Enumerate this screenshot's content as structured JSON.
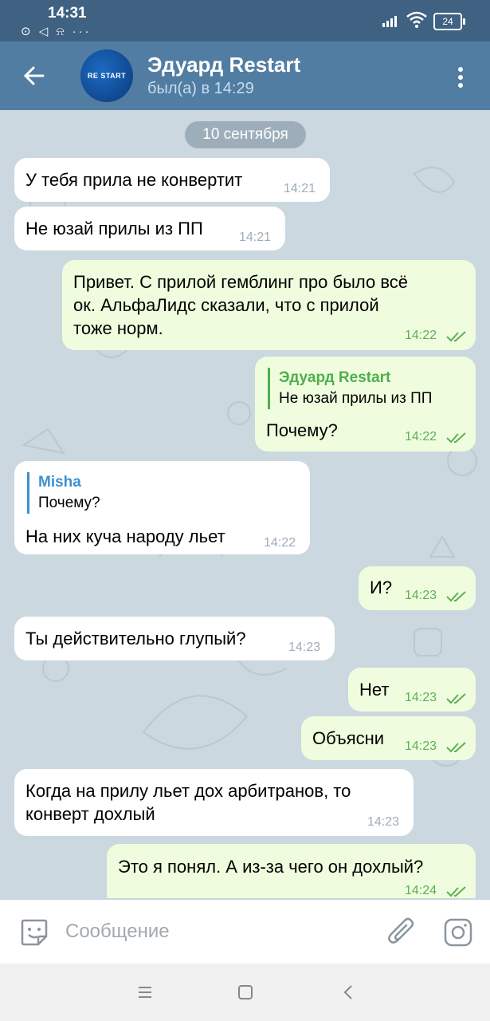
{
  "status_bar": {
    "time": "14:31",
    "left_icons": "⊙ ◁ ⍾ ···",
    "battery": "24"
  },
  "header": {
    "name": "Эдуард Restart",
    "status": "был(а) в 14:29",
    "avatar_text": "RE START"
  },
  "date_separator": "10 сентября",
  "messages": [
    {
      "dir": "in",
      "text": "У тебя прила не конвертит",
      "time": "14:21"
    },
    {
      "dir": "in",
      "text": "Не юзай прилы из ПП",
      "time": "14:21"
    },
    {
      "dir": "out",
      "lines": [
        "Привет. С прилой гемблинг про было всё",
        "ок. АльфаЛидс сказали, что с прилой",
        "тоже норм."
      ],
      "time": "14:22"
    },
    {
      "dir": "out",
      "reply_name": "Эдуард Restart",
      "reply_text": "Не юзай прилы из ПП",
      "text": "Почему?",
      "time": "14:22"
    },
    {
      "dir": "in",
      "reply_name": "Misha",
      "reply_text": "Почему?",
      "text": "На них куча народу льет",
      "time": "14:22"
    },
    {
      "dir": "out",
      "text": "И?",
      "time": "14:23"
    },
    {
      "dir": "in",
      "text": "Ты действительно глупый?",
      "time": "14:23"
    },
    {
      "dir": "out",
      "text": "Нет",
      "time": "14:23"
    },
    {
      "dir": "out",
      "text": "Объясни",
      "time": "14:23"
    },
    {
      "dir": "in",
      "lines": [
        "Когда на прилу льет дох арбитранов, то",
        "конверт дохлый"
      ],
      "time": "14:23"
    },
    {
      "dir": "out",
      "text": "Это я понял. А из-за чего он дохлый?",
      "time": "14:24"
    }
  ],
  "input": {
    "placeholder": "Сообщение"
  },
  "colors": {
    "header": "#517da2",
    "status_bar": "#3f6283",
    "outgoing_bubble": "#effdde",
    "incoming_bubble": "#ffffff",
    "check_green": "#5fae57",
    "reply_in": "#3d91cf",
    "reply_out": "#4fae4e"
  }
}
